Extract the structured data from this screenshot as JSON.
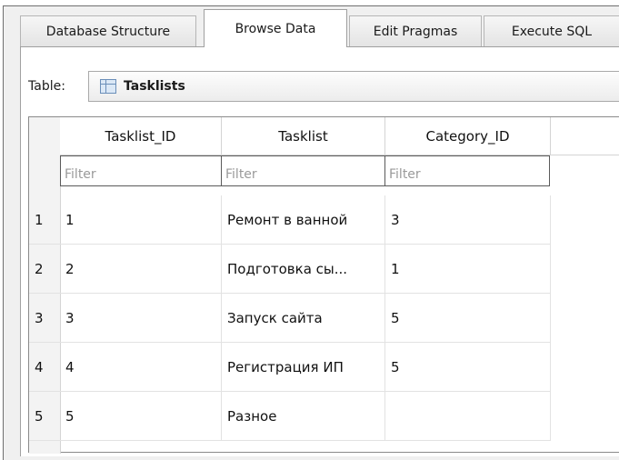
{
  "tabs": [
    {
      "label": "Database Structure"
    },
    {
      "label": "Browse Data",
      "active": true
    },
    {
      "label": "Edit Pragmas"
    },
    {
      "label": "Execute SQL"
    }
  ],
  "table_selector": {
    "label": "Table:",
    "value": "Tasklists",
    "icon": "table-icon"
  },
  "grid": {
    "columns": [
      "Tasklist_ID",
      "Tasklist",
      "Category_ID"
    ],
    "filter_placeholder": "Filter",
    "rows": [
      {
        "num": "1",
        "cells": [
          "1",
          "Ремонт в ванной",
          "3"
        ]
      },
      {
        "num": "2",
        "cells": [
          "2",
          "Подготовка сы...",
          "1"
        ]
      },
      {
        "num": "3",
        "cells": [
          "3",
          "Запуск сайта",
          "5"
        ]
      },
      {
        "num": "4",
        "cells": [
          "4",
          "Регистрация ИП",
          "5"
        ]
      },
      {
        "num": "5",
        "cells": [
          "5",
          "Разное",
          ""
        ]
      }
    ]
  }
}
